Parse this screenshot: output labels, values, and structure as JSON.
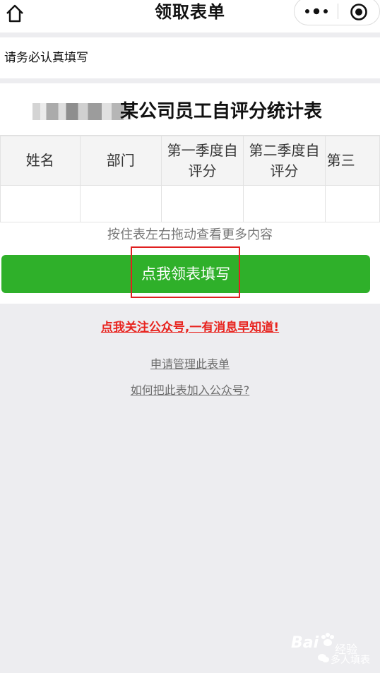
{
  "header": {
    "title": "领取表单",
    "home_icon": "home-icon",
    "more_icon": "more-dots-icon",
    "close_icon": "target-close-icon"
  },
  "notice": {
    "text": "请务必认真填写"
  },
  "form": {
    "title": "某公司员工自评分统计表",
    "columns": [
      "姓名",
      "部门",
      "第一季度自评分",
      "第二季度自评分",
      "第三"
    ],
    "hint": "按住表左右拖动查看更多内容",
    "primary_button": "点我领表填写"
  },
  "links": {
    "follow": "点我关注公众号,一有消息早知道!",
    "manage": "申请管理此表单",
    "howto": "如何把此表加入公众号?"
  },
  "watermark": {
    "brand": "Bai",
    "brand2": "经验",
    "sub": "多人填表"
  },
  "colors": {
    "primary": "#2fb02a",
    "alert_red": "#e8241f",
    "highlight": "#e02020",
    "background": "#ededf0"
  }
}
